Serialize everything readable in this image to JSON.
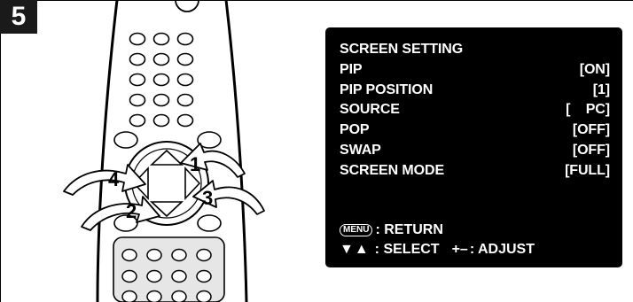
{
  "step": {
    "number": "5"
  },
  "remote": {
    "callouts": [
      "1",
      "2",
      "3",
      "4"
    ]
  },
  "osd": {
    "rows": [
      {
        "label": "SCREEN SETTING",
        "value": ""
      },
      {
        "label": "PIP",
        "value": "[ON]"
      },
      {
        "label": "PIP POSITION",
        "value": "[1]"
      },
      {
        "label": "SOURCE",
        "value": "[    PC]"
      },
      {
        "label": "POP",
        "value": "[OFF]"
      },
      {
        "label": "SWAP",
        "value": "[OFF]"
      },
      {
        "label": "SCREEN MODE",
        "value": "[FULL]"
      }
    ],
    "footer": {
      "menu_key": "MENU",
      "return_text": ": RETURN",
      "select_arrows": "▼▲",
      "select_text": ": SELECT",
      "adjust_arrows": "+–",
      "adjust_text": ": ADJUST"
    }
  },
  "colors": {
    "osd_bg": "#000000",
    "osd_text": "#ffffff",
    "badge_bg": "#1a1a1a"
  }
}
